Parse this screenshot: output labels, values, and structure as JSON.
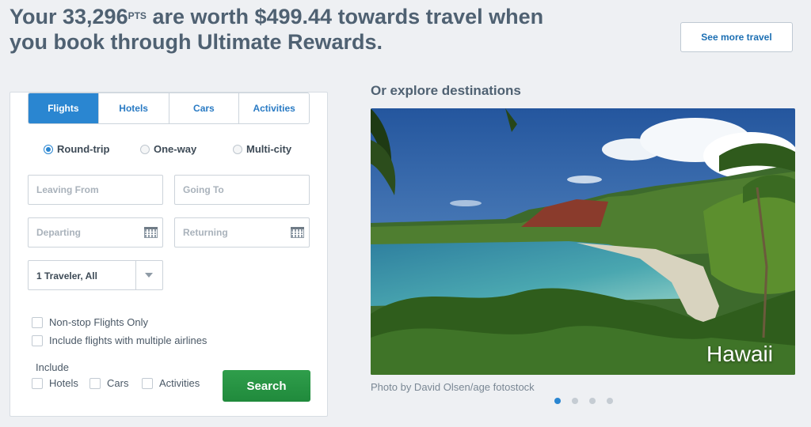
{
  "header": {
    "headline_prefix": "Your 33,296",
    "pts_label": "PTS",
    "headline_rest": " are worth $499.44 towards travel when",
    "headline_line2": "you book through Ultimate Rewards.",
    "see_more_label": "See more travel"
  },
  "booking": {
    "tabs": [
      "Flights",
      "Hotels",
      "Cars",
      "Activities"
    ],
    "active_tab": "Flights",
    "trip_types": [
      "Round-trip",
      "One-way",
      "Multi-city"
    ],
    "selected_trip_type": "Round-trip",
    "leaving_from_placeholder": "Leaving From",
    "going_to_placeholder": "Going To",
    "departing_placeholder": "Departing",
    "returning_placeholder": "Returning",
    "travelers_value": "1 Traveler, All",
    "nonstop_label": "Non-stop Flights Only",
    "multiple_airlines_label": "Include flights with multiple airlines",
    "include_label": "Include",
    "include_options": [
      "Hotels",
      "Cars",
      "Activities"
    ],
    "search_label": "Search"
  },
  "explore": {
    "title": "Or explore destinations",
    "destination": "Hawaii",
    "credit": "Photo by David Olsen/age fotostock",
    "carousel_count": 4,
    "carousel_active_index": 0
  },
  "colors": {
    "accent": "#2a86d1",
    "search_green": "#2f9e4b",
    "headline": "#4f6172"
  }
}
